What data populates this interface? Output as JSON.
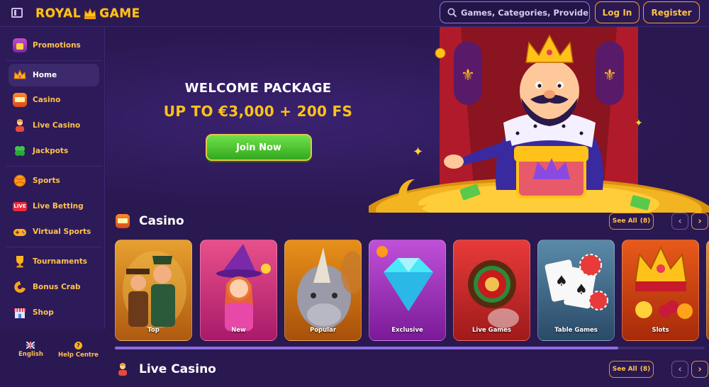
{
  "header": {
    "logo_text_1": "ROYAL",
    "logo_text_2": "GAME",
    "search_placeholder": "Games, Categories, Providers",
    "login_label": "Log In",
    "register_label": "Register"
  },
  "sidebar": {
    "items": [
      {
        "label": "Promotions",
        "icon": "gift-icon"
      },
      {
        "label": "Home",
        "icon": "crown-icon"
      },
      {
        "label": "Casino",
        "icon": "slot-machine-icon"
      },
      {
        "label": "Live Casino",
        "icon": "dealer-icon"
      },
      {
        "label": "Jackpots",
        "icon": "clover-icon"
      },
      {
        "label": "Sports",
        "icon": "ball-icon"
      },
      {
        "label": "Live Betting",
        "icon": "live-icon"
      },
      {
        "label": "Virtual Sports",
        "icon": "gamepad-icon"
      },
      {
        "label": "Tournaments",
        "icon": "trophy-icon"
      },
      {
        "label": "Bonus Crab",
        "icon": "crab-icon"
      },
      {
        "label": "Shop",
        "icon": "shop-icon"
      }
    ],
    "live_badge": "LIVE",
    "footer": {
      "language": "English",
      "help": "Help Centre",
      "help_icon_text": "?"
    }
  },
  "hero": {
    "title": "WELCOME PACKAGE",
    "subtitle": "UP TO €3,000 + 200 FS",
    "cta": "Join Now"
  },
  "sections": {
    "casino": {
      "title": "Casino",
      "see_all": "See All",
      "count": "(8)",
      "prev": "‹",
      "next": "›"
    },
    "live_casino": {
      "title": "Live Casino",
      "see_all": "See All",
      "count": "(8)",
      "prev": "‹",
      "next": "›"
    }
  },
  "cards": [
    {
      "label": "Top"
    },
    {
      "label": "New"
    },
    {
      "label": "Popular"
    },
    {
      "label": "Exclusive"
    },
    {
      "label": "Live Games"
    },
    {
      "label": "Table Games"
    },
    {
      "label": "Slots"
    }
  ],
  "colors": {
    "background": "#2a1850",
    "accent_gold": "#ffc21a",
    "accent_orange": "#f2a52a",
    "cta_green": "#4cc832"
  }
}
